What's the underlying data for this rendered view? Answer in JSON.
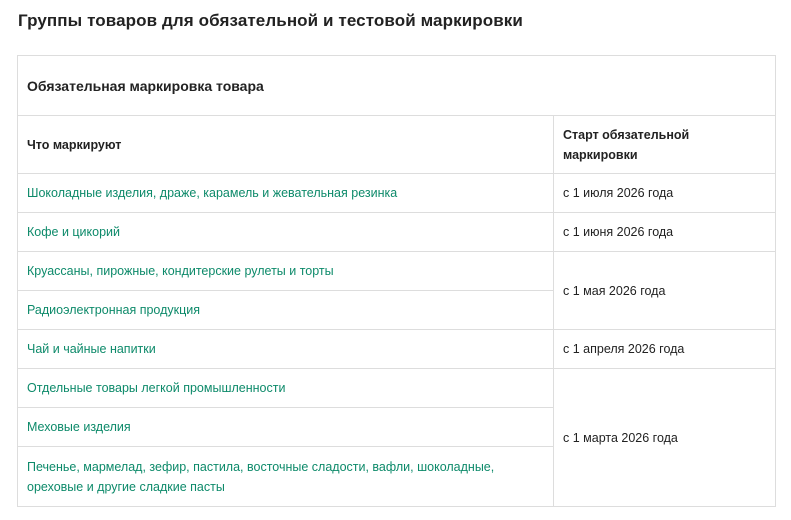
{
  "page": {
    "title": "Группы товаров для обязательной и тестовой маркировки"
  },
  "table": {
    "section_title": "Обязательная маркировка товара",
    "headers": {
      "product": "Что маркируют",
      "start": "Старт обязательной маркировки"
    },
    "rows": [
      {
        "product": "Шоколадные изделия, драже, карамель и жевательная резинка",
        "start": "с 1 июля 2026 года"
      },
      {
        "product": "Кофе и цикорий",
        "start": "с 1 июня 2026 года"
      },
      {
        "product": "Круассаны, пирожные, кондитерские рулеты и торты",
        "start": "с 1 мая 2026 года"
      },
      {
        "product": "Радиоэлектронная продукция",
        "start": "с 1 мая 2026 года"
      },
      {
        "product": "Чай и чайные напитки",
        "start": "с 1 апреля 2026 года"
      },
      {
        "product": "Отдельные товары легкой промышленности",
        "start": "с 1 марта 2026 года"
      },
      {
        "product": "Меховые изделия",
        "start": "с 1 марта 2026 года"
      },
      {
        "product": "Печенье, мармелад, зефир, пастила, восточные сладости, вафли, шоколадные, ореховые и другие сладкие пасты",
        "start": "с 1 марта 2026 года"
      }
    ]
  },
  "colors": {
    "link": "#0d8a6a",
    "text": "#222222",
    "border": "#dddddd"
  }
}
